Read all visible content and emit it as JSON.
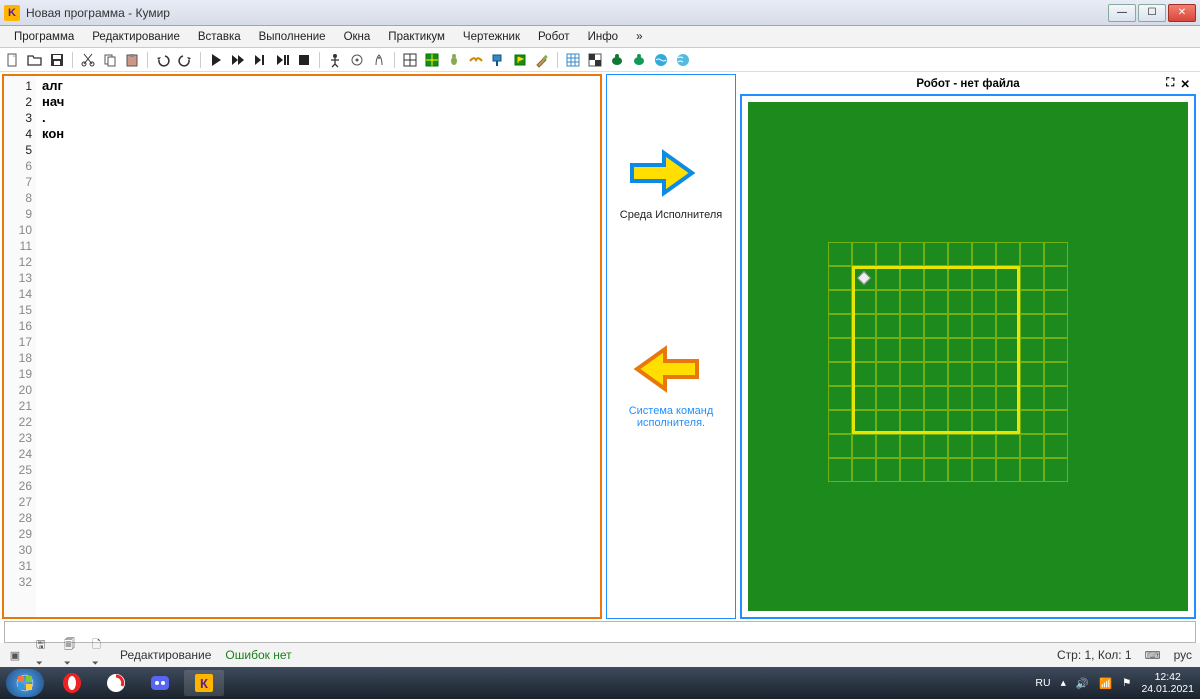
{
  "window": {
    "title": "Новая программа - Кумир",
    "app_icon_letter": "K"
  },
  "menus": [
    "Программа",
    "Редактирование",
    "Вставка",
    "Выполнение",
    "Окна",
    "Практикум",
    "Чертежник",
    "Робот",
    "Инфо",
    "»"
  ],
  "code": {
    "max_line": 32,
    "active_lines": 5,
    "lines": [
      "алг",
      "нач",
      ".",
      "кон",
      ""
    ]
  },
  "mid_panel": {
    "label1": "Среда Исполнителя",
    "label2a": "Система команд",
    "label2b": "исполнителя."
  },
  "right_panel": {
    "title": "Робот - нет файла"
  },
  "status": {
    "mode": "Редактирование",
    "errors": "Ошибок нет",
    "cursor": "Стр: 1, Кол: 1",
    "lang_indicator": "рус"
  },
  "taskbar": {
    "lang": "RU",
    "time": "12:42",
    "date": "24.01.2021"
  }
}
